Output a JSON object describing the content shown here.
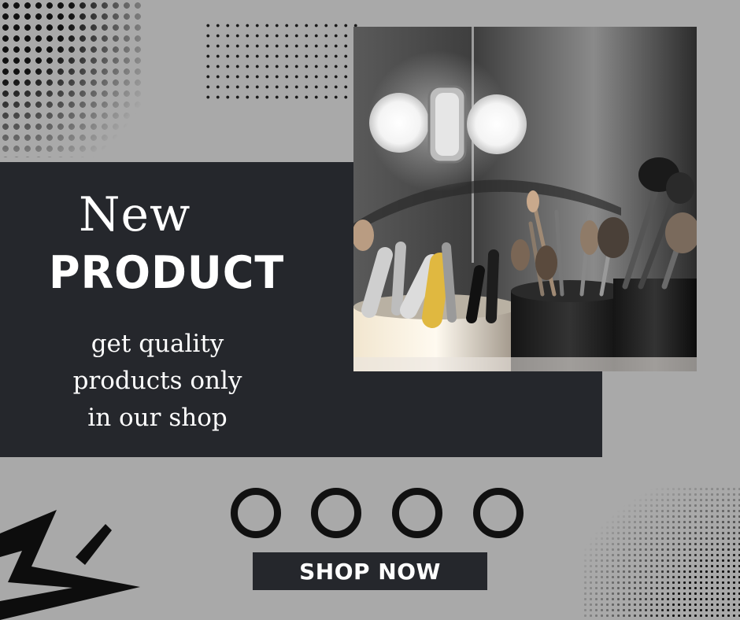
{
  "headline": {
    "line1": "New",
    "line2": "PRODUCT"
  },
  "tagline": {
    "lines": [
      "get quality",
      "products only",
      "in our shop"
    ]
  },
  "cta": {
    "label": "SHOP NOW"
  },
  "decor": {
    "ring_count": 4,
    "colors": {
      "background": "#a9a9a9",
      "panel": "#25272c",
      "text": "#ffffff",
      "accent_dark": "#111111"
    },
    "icons": [
      "halftone-pattern",
      "dot-grid",
      "lightning-bolt-icon"
    ]
  },
  "photo": {
    "subject": "makeup brushes in cups with vanity mirror bulb"
  }
}
